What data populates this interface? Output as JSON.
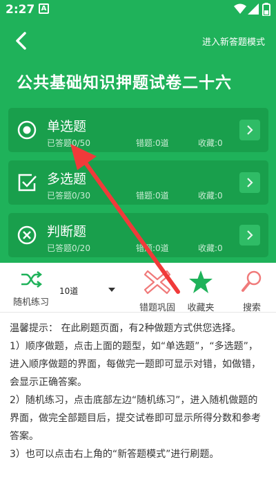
{
  "status_bar": {
    "time": "2:27",
    "notification_icon": "A"
  },
  "header": {
    "new_mode_label": "进入新答题模式",
    "title": "公共基础知识押题试卷二十六"
  },
  "question_types": [
    {
      "title": "单选题",
      "answered": "已答题0/50",
      "wrong": "错题:0道",
      "favorites": "收藏:0",
      "icon": "radio-circle-icon"
    },
    {
      "title": "多选题",
      "answered": "已答题0/30",
      "wrong": "错题:0道",
      "favorites": "收藏:0",
      "icon": "checkbox-check-icon"
    },
    {
      "title": "判断题",
      "answered": "已答题0/20",
      "wrong": "错题:0道",
      "favorites": "收藏:0",
      "icon": "circle-x-icon"
    }
  ],
  "toolbar": {
    "random_label": "随机练习",
    "count_value": "10道",
    "wrong_label": "错题巩固",
    "favorites_label": "收藏夹",
    "search_label": "搜索"
  },
  "tips": [
    "温馨提示：  在此刷题页面，有2种做题方式供您选择。",
    "1）顺序做题，点击上面的题型，如“单选题”，“多选题”，进入顺序做题的界面，每做完一题即可显示对错，如做错，会显示正确答案。",
    "2）随机练习，点击底部左边“随机练习”，进入随机做题的界面，做完全部题目后，提交试卷即可显示所得分数和参考答案。",
    "3）也可以点击右上角的“新答题模式”进行刷题。"
  ],
  "colors": {
    "primary_green": "#1fb25a",
    "card_green": "#199f4c",
    "annotation_red": "#f03a3a",
    "wrong_icon_pink": "#f07a7a",
    "fav_icon_green": "#1fb25a"
  }
}
